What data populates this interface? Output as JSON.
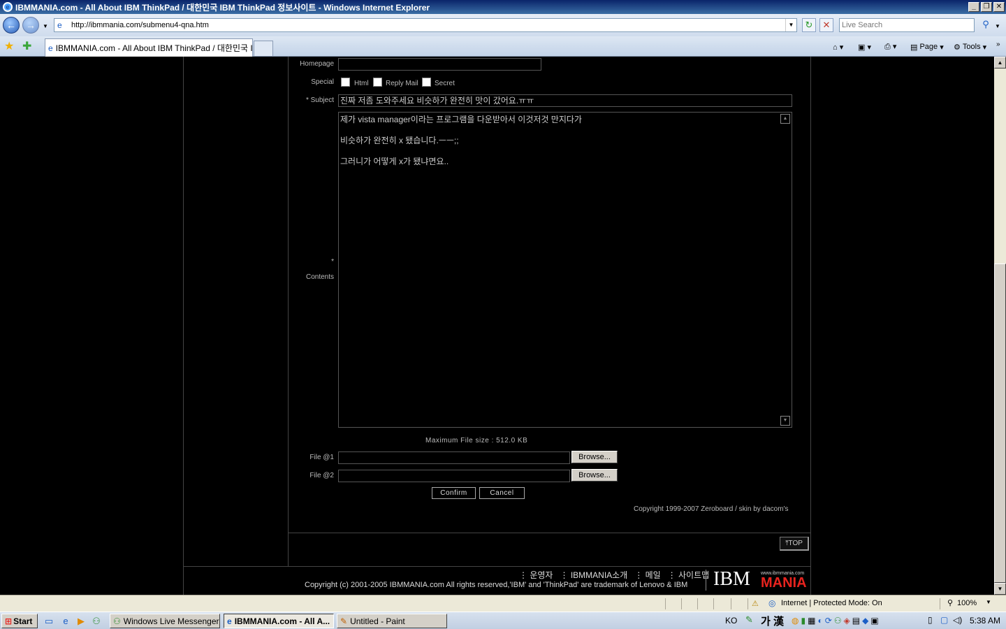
{
  "window": {
    "title": "IBMMANIA.com - All About IBM ThinkPad / 대한민국 IBM ThinkPad 정보사이트 - Windows Internet Explorer",
    "caption_buttons": [
      "_",
      "❐",
      "✕"
    ]
  },
  "toolbar": {
    "url": "http://ibmmania.com/submenu4-qna.htm",
    "search_placeholder": "Live Search",
    "tab_title": "IBMMANIA.com - All About IBM ThinkPad / 대한민국 I...",
    "page_label": "Page",
    "tools_label": "Tools"
  },
  "form": {
    "homepage_label": "Homepage",
    "special_label": "Special",
    "html_label": "Html",
    "reply_mail_label": "Reply Mail",
    "secret_label": "Secret",
    "subject_star": "*",
    "subject_label": "Subject",
    "subject_value": "진짜 저좀 도와주세요 비슷하가 완전히 맛이 갔어요.ㅠㅠ",
    "contents_star": "*",
    "contents_label": "Contents",
    "contents_lines": [
      "제가 vista manager이라는 프로그램을 다운받아서 이것저것 만지다가",
      "비슷하가 완전히 x 됐습니다.ㅡㅡ;;",
      "그러니가 어떻게 x가 됐냐면요.."
    ],
    "max_file_size": "Maximum File size : 512.0 KB",
    "file1_label": "File @1",
    "file2_label": "File @2",
    "browse_label": "Browse...",
    "confirm_label": "Confirm",
    "cancel_label": "Cancel",
    "copyright_board": "Copyright 1999-2007 Zeroboard / skin by dacom's",
    "top_label": "TOP"
  },
  "footer": {
    "links": [
      "운영자",
      "IBMMANIA소개",
      "메일",
      "사이트맵"
    ],
    "copyright": "Copyright (c) 2001-2005 IBMMANIA.com All rights reserved,'IBM' and 'ThinkPad' are trademark of Lenovo & IBM",
    "logo_ibm": "IBM",
    "logo_mania": "MANIA",
    "logo_url": "www.ibmmania.com"
  },
  "status": {
    "zone": "Internet | Protected Mode: On",
    "zoom": "100%"
  },
  "taskbar": {
    "start": "Start",
    "items": [
      "Windows Live Messenger",
      "IBMMANIA.com - All A...",
      "Untitled - Paint"
    ],
    "lang": "KO",
    "ime": "가 漢",
    "clock": "5:38 AM"
  }
}
